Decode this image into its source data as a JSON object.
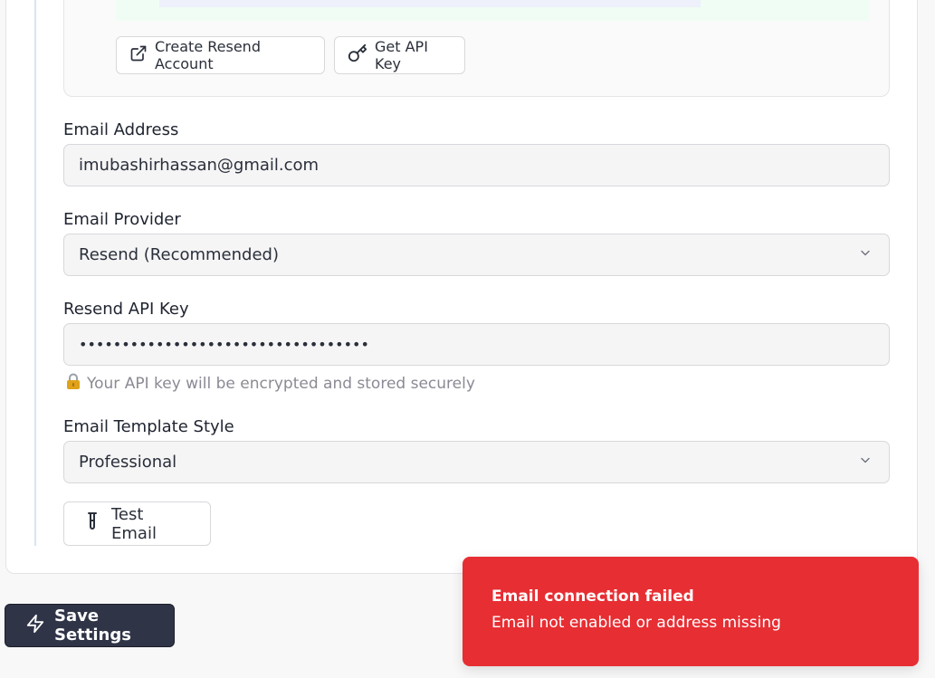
{
  "resend_setup": {
    "create_account_label": "Create Resend Account",
    "get_api_key_label": "Get API Key"
  },
  "form": {
    "email_address": {
      "label": "Email Address",
      "value": "imubashirhassan@gmail.com"
    },
    "email_provider": {
      "label": "Email Provider",
      "value": "Resend (Recommended)"
    },
    "resend_api_key": {
      "label": "Resend API Key",
      "value": "••••••••••••••••••••••••••••••••••",
      "helper": "Your API key will be encrypted and stored securely"
    },
    "template_style": {
      "label": "Email Template Style",
      "value": "Professional"
    },
    "test_email_label": "Test Email"
  },
  "actions": {
    "save_label": "Save Settings"
  },
  "toast": {
    "title": "Email connection failed",
    "message": "Email not enabled or address missing"
  },
  "icons": {
    "external_link": "external-link-icon",
    "key": "key-icon",
    "chevron_down": "chevron-down-icon",
    "lock": "lock-icon",
    "test_tube": "test-tube-icon",
    "lightning": "lightning-icon"
  },
  "colors": {
    "toast_background": "#e72e33",
    "save_button_background": "#2f3447",
    "lock_icon": "#e0a21a"
  }
}
